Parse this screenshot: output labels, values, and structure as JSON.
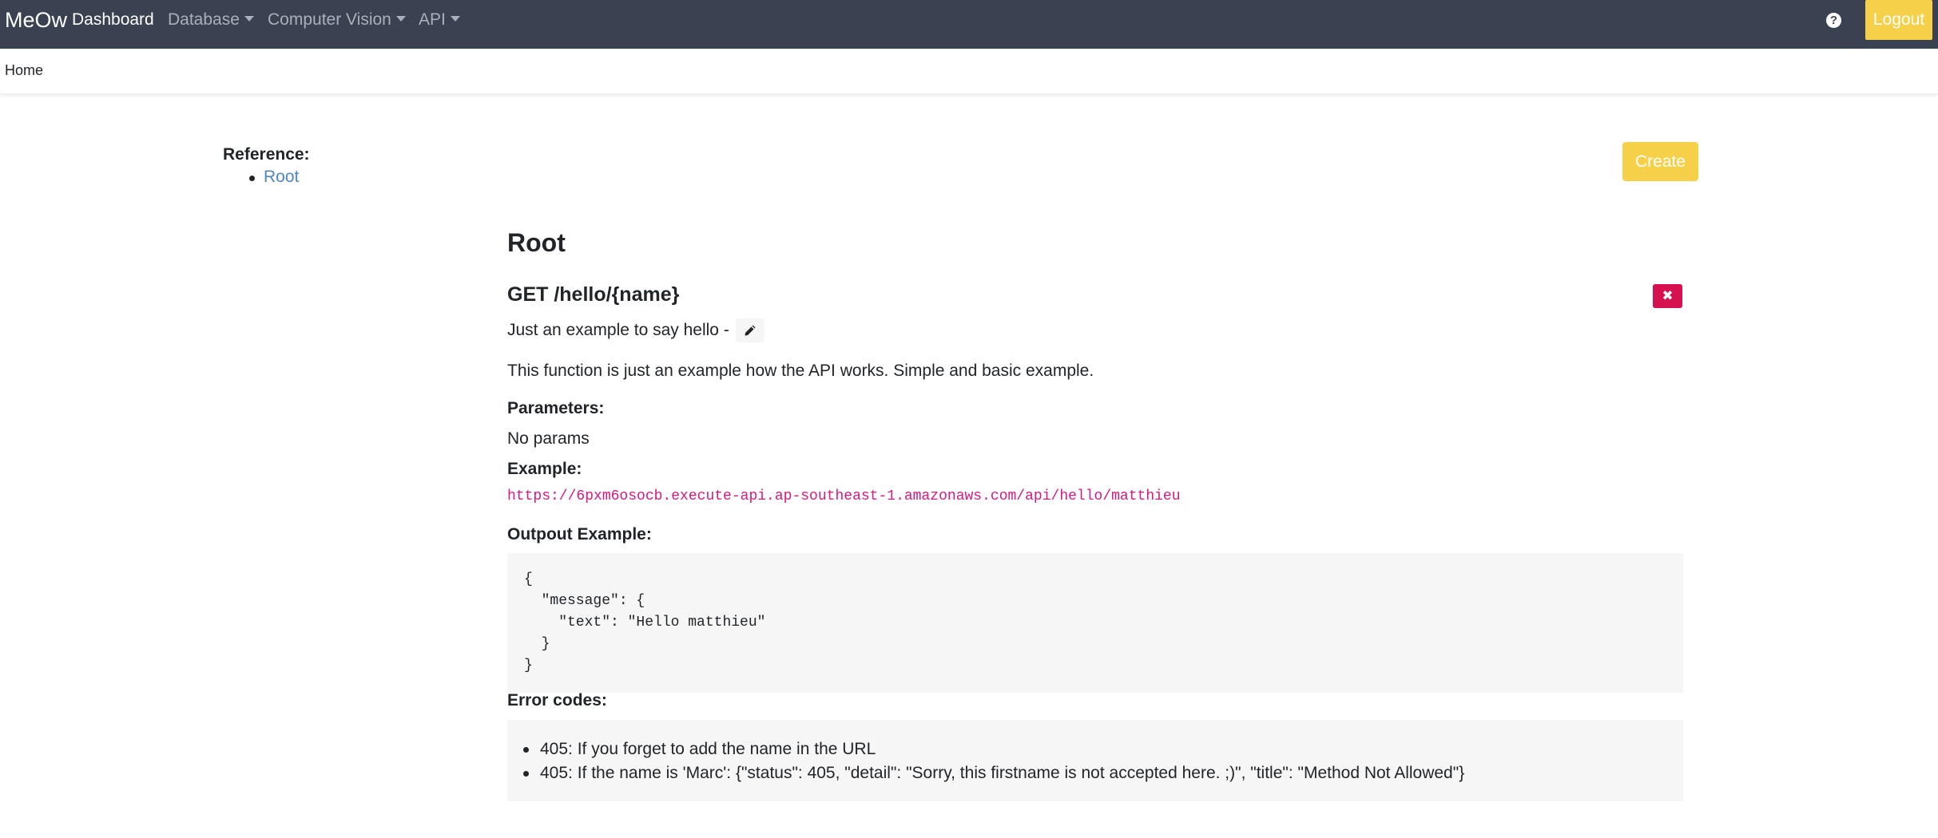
{
  "navbar": {
    "brand": "MeOw",
    "links": [
      {
        "label": "Dashboard",
        "active": true
      },
      {
        "label": "Database",
        "dropdown": true
      },
      {
        "label": "Computer Vision",
        "dropdown": true
      },
      {
        "label": "API",
        "dropdown": true
      }
    ],
    "help_icon": "question-circle-icon",
    "logout_label": "Logout"
  },
  "breadcrumb": {
    "home": "Home"
  },
  "reference": {
    "title": "Reference:",
    "items": [
      "Root"
    ]
  },
  "create_label": "Create",
  "section": {
    "title": "Root"
  },
  "endpoint": {
    "title": "GET /hello/{name}",
    "summary": "Just an example to say hello -",
    "description": "This function is just an example how the API works. Simple and basic example.",
    "parameters_label": "Parameters:",
    "parameters_value": "No params",
    "example_label": "Example:",
    "example_url": "https://6pxm6osocb.execute-api.ap-southeast-1.amazonaws.com/api/hello/matthieu",
    "output_label": "Outpout Example:",
    "output_code": "{\n  \"message\": {\n    \"text\": \"Hello matthieu\"\n  }\n}",
    "errors_label": "Error codes:",
    "errors": [
      "405: If you forget to add the name in the URL",
      "405: If the name is 'Marc': {\"status\": 405, \"detail\": \"Sorry, this firstname is not accepted here. ;)\", \"title\": \"Method Not Allowed\"}"
    ]
  },
  "colors": {
    "navbar_bg": "#3a4252",
    "accent_yellow": "#f7d04a",
    "danger": "#d6114f",
    "link": "#4f86c6",
    "code_pink": "#d6197f"
  }
}
